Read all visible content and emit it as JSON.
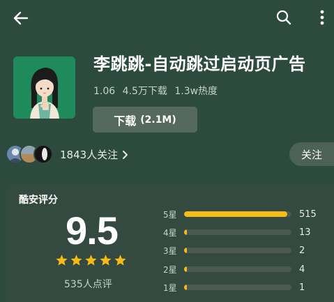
{
  "header": {
    "back_icon": "arrow-left-icon",
    "search_icon": "search-icon",
    "more_icon": "more-vertical-icon"
  },
  "app": {
    "title": "李跳跳-自动跳过启动页广告",
    "version": "1.06",
    "downloads": "4.5万下载",
    "heat": "1.3w热度",
    "download_label": "下载",
    "download_size": "(2.1M)",
    "icon_bg": "#1f8a5c"
  },
  "social": {
    "followers_text": "1843人关注",
    "follow_label": "关注"
  },
  "rating": {
    "title": "酷安评分",
    "score": "9.5",
    "stars": 5,
    "count_text": "535人点评",
    "bar_color": "#f6bb16",
    "distribution": [
      {
        "label": "5星",
        "count": "515",
        "fraction": 0.963
      },
      {
        "label": "4星",
        "count": "13",
        "fraction": 0.024
      },
      {
        "label": "3星",
        "count": "2",
        "fraction": 0.004
      },
      {
        "label": "2星",
        "count": "4",
        "fraction": 0.007
      },
      {
        "label": "1星",
        "count": "1",
        "fraction": 0.002
      }
    ]
  }
}
